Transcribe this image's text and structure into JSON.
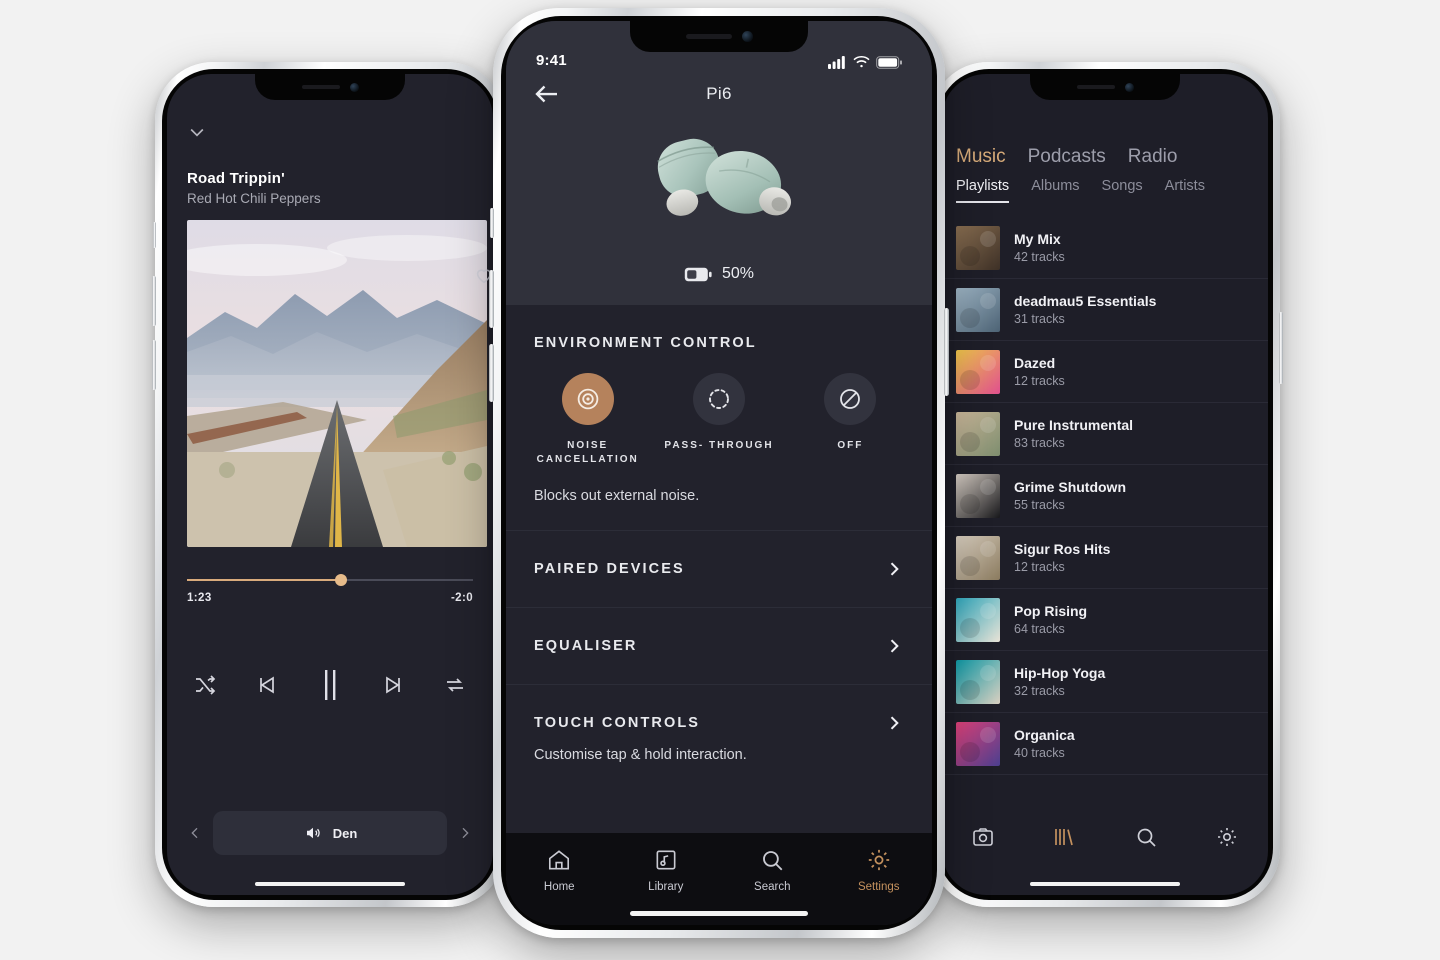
{
  "page": {
    "background": "#f2f2f2",
    "accent": "#c4915e"
  },
  "left_phone": {
    "collapse_icon": "chevron-down-icon",
    "track_title": "Road Trippin'",
    "track_artist": "Red Hot Chili Peppers",
    "album_art_alt": "desert highway album art",
    "favorite_icon": "heart-icon",
    "elapsed": "1:23",
    "remaining": "-2:0",
    "progress_percent": 54,
    "controls": [
      {
        "name": "shuffle",
        "icon": "shuffle-icon"
      },
      {
        "name": "previous",
        "icon": "skip-previous-icon"
      },
      {
        "name": "pause",
        "icon": "pause-icon"
      },
      {
        "name": "next",
        "icon": "skip-next-icon"
      },
      {
        "name": "repeat",
        "icon": "repeat-icon"
      }
    ],
    "output_device": "Den",
    "output_icon": "speaker-icon",
    "prev_icon": "chevron-left-icon",
    "next_icon": "chevron-right-icon"
  },
  "center_phone": {
    "status": {
      "time": "9:41",
      "cellular": "signal-icon",
      "wifi": "wifi-icon",
      "battery": "battery-icon"
    },
    "header": {
      "back_icon": "arrow-left-icon",
      "title": "Pi6"
    },
    "device": {
      "image_alt": "wireless earbuds",
      "battery_percent": "50%",
      "battery_level": 50
    },
    "environment": {
      "section_title": "ENVIRONMENT CONTROL",
      "modes": [
        {
          "label": "NOISE CANCELLATION",
          "icon": "noise-cancellation-icon",
          "selected": true
        },
        {
          "label": "PASS- THROUGH",
          "icon": "pass-through-icon",
          "selected": false
        },
        {
          "label": "OFF",
          "icon": "off-icon",
          "selected": false
        }
      ],
      "description": "Blocks out external noise."
    },
    "items": [
      {
        "label": "PAIRED DEVICES",
        "sub": "",
        "chevron": "chevron-right-icon"
      },
      {
        "label": "EQUALISER",
        "sub": "",
        "chevron": "chevron-right-icon"
      },
      {
        "label": "TOUCH CONTROLS",
        "sub": "Customise tap & hold interaction.",
        "chevron": "chevron-right-icon"
      }
    ],
    "tabbar": [
      {
        "label": "Home",
        "icon": "home-icon",
        "active": false
      },
      {
        "label": "Library",
        "icon": "library-icon",
        "active": false
      },
      {
        "label": "Search",
        "icon": "search-icon",
        "active": false
      },
      {
        "label": "Settings",
        "icon": "gear-icon",
        "active": true
      }
    ]
  },
  "right_phone": {
    "top_tabs": [
      {
        "label": "Music",
        "active": true
      },
      {
        "label": "Podcasts",
        "active": false
      },
      {
        "label": "Radio",
        "active": false
      }
    ],
    "sub_tabs": [
      {
        "label": "Playlists",
        "active": true
      },
      {
        "label": "Albums",
        "active": false
      },
      {
        "label": "Songs",
        "active": false
      },
      {
        "label": "Artists",
        "active": false
      }
    ],
    "playlists": [
      {
        "name": "My Mix",
        "tracks": "42 tracks",
        "c1": "#8a6f52",
        "c2": "#3d3026"
      },
      {
        "name": "deadmau5 Essentials",
        "tracks": "31 tracks",
        "c1": "#9fb6c6",
        "c2": "#4c6274"
      },
      {
        "name": "Dazed",
        "tracks": "12 tracks",
        "c1": "#f0c84a",
        "c2": "#e04f8e"
      },
      {
        "name": "Pure Instrumental",
        "tracks": "83 tracks",
        "c1": "#cbb79a",
        "c2": "#7d8d6e"
      },
      {
        "name": "Grime Shutdown",
        "tracks": "55 tracks",
        "c1": "#d8cfc6",
        "c2": "#17171a"
      },
      {
        "name": "Sigur Ros Hits",
        "tracks": "12 tracks",
        "c1": "#d9cfc0",
        "c2": "#8a7a5e"
      },
      {
        "name": "Pop Rising",
        "tracks": "64 tracks",
        "c1": "#2fa8bd",
        "c2": "#e8e2d6"
      },
      {
        "name": "Hip-Hop Yoga",
        "tracks": "32 tracks",
        "c1": "#0f9ba8",
        "c2": "#d9cfc0"
      },
      {
        "name": "Organica",
        "tracks": "40 tracks",
        "c1": "#e0427a",
        "c2": "#4b3f8f"
      }
    ],
    "nav": [
      {
        "icon": "camera-icon",
        "active": false
      },
      {
        "icon": "library-books-icon",
        "active": true
      },
      {
        "icon": "search-icon",
        "active": false
      },
      {
        "icon": "gear-icon",
        "active": false
      }
    ]
  }
}
